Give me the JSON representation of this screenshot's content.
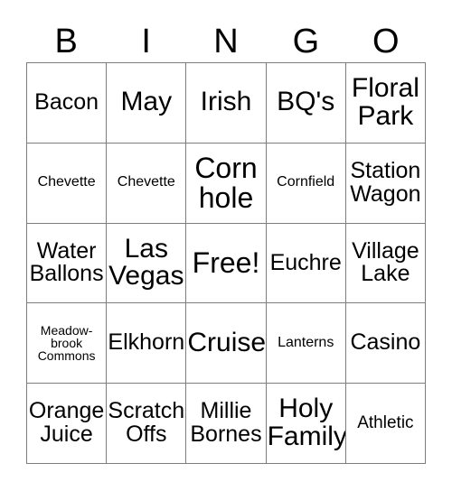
{
  "card": {
    "type": "bingo-card",
    "header_letters": [
      "B",
      "I",
      "N",
      "G",
      "O"
    ],
    "grid_size": "5x5",
    "colors": {
      "background": "#ffffff",
      "text": "#000000",
      "grid_line": "#7d7d7d"
    },
    "rows": [
      [
        {
          "text": "Bacon",
          "size": "md"
        },
        {
          "text": "May",
          "size": "lg"
        },
        {
          "text": "Irish",
          "size": "lg"
        },
        {
          "text": "BQ's",
          "size": "lg"
        },
        {
          "text": "Floral\nPark",
          "size": "lg"
        }
      ],
      [
        {
          "text": "Chevette",
          "size": "xs"
        },
        {
          "text": "Chevette",
          "size": "xs"
        },
        {
          "text": "Corn\nhole",
          "size": "xl"
        },
        {
          "text": "Cornfield",
          "size": "xs"
        },
        {
          "text": "Station\nWagon",
          "size": "md"
        }
      ],
      [
        {
          "text": "Water\nBallons",
          "size": "md"
        },
        {
          "text": "Las\nVegas",
          "size": "lg"
        },
        {
          "text": "Free!",
          "size": "xl"
        },
        {
          "text": "Euchre",
          "size": "md"
        },
        {
          "text": "Village\nLake",
          "size": "md"
        }
      ],
      [
        {
          "text": "Meadow-\nbrook\nCommons",
          "size": "xxs"
        },
        {
          "text": "Elkhorn",
          "size": "md"
        },
        {
          "text": "Cruise",
          "size": "lg"
        },
        {
          "text": "Lanterns",
          "size": "xs"
        },
        {
          "text": "Casino",
          "size": "md"
        }
      ],
      [
        {
          "text": "Orange\nJuice",
          "size": "md"
        },
        {
          "text": "Scratch\nOffs",
          "size": "md"
        },
        {
          "text": "Millie\nBornes",
          "size": "md"
        },
        {
          "text": "Holy\nFamily",
          "size": "lg"
        },
        {
          "text": "Athletic",
          "size": "sm"
        }
      ]
    ]
  }
}
